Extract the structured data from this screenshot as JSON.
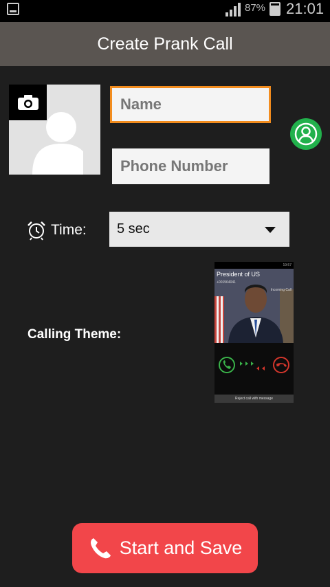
{
  "status_bar": {
    "battery": "87%",
    "time": "21:01"
  },
  "app_bar": {
    "title": "Create Prank Call"
  },
  "form": {
    "name_placeholder": "Name",
    "phone_placeholder": "Phone Number",
    "time_label": "Time:",
    "time_value": "5 sec",
    "theme_label": "Calling Theme:"
  },
  "theme_preview": {
    "caller_name": "President of US",
    "caller_number": "+001564041",
    "incoming_text": "Incoming Call",
    "status_time": "19:57",
    "reject_text": "Reject call with message"
  },
  "actions": {
    "start_label": "Start and Save"
  },
  "icons": {
    "camera": "camera-icon",
    "contacts": "contact-picker-icon",
    "alarm": "alarm-clock-icon",
    "phone": "phone-icon",
    "dropdown": "chevron-down-icon"
  },
  "colors": {
    "accent_orange": "#f28c1e",
    "contacts_green": "#22b14c",
    "start_red": "#f2464a",
    "appbar": "#5a5551"
  }
}
